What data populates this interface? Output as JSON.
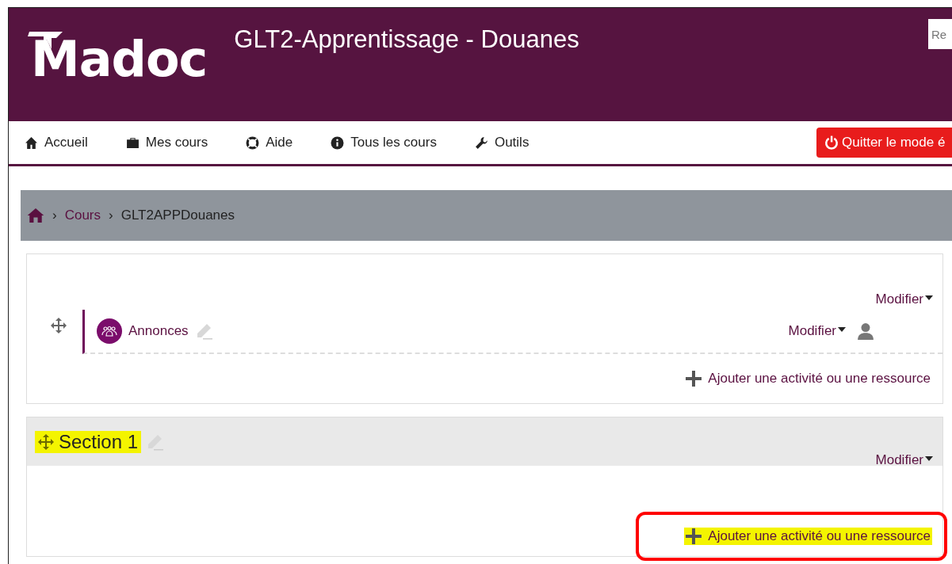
{
  "header": {
    "logo": "Madoc",
    "title": "GLT2-Apprentissage - Douanes",
    "search": {
      "placeholder": "Re"
    }
  },
  "nav": {
    "items": [
      {
        "kind": "home",
        "label": "Accueil"
      },
      {
        "kind": "briefcase",
        "label": "Mes cours"
      },
      {
        "kind": "lifebuoy",
        "label": "Aide"
      },
      {
        "kind": "info",
        "label": "Tous les cours"
      },
      {
        "kind": "wrench",
        "label": "Outils"
      }
    ],
    "edit_button": "Quitter le mode é"
  },
  "breadcrumb": [
    {
      "separator": "›",
      "label": "Cours",
      "link": true
    },
    {
      "separator": "›",
      "label": "GLT2APPDouanes",
      "link": false
    }
  ],
  "sections": [
    {
      "menu": "Modifier",
      "activities": [
        {
          "name": "Annonces",
          "menu": "Modifier"
        }
      ],
      "add": {
        "label": "Ajouter une activité ou une ressource",
        "highlighted": false,
        "circled": false
      }
    },
    {
      "title": "Section 1",
      "title_highlighted": true,
      "menu": "Modifier",
      "add": {
        "label": "Ajouter une activité ou une ressource",
        "highlighted": true,
        "circled": true
      }
    }
  ]
}
